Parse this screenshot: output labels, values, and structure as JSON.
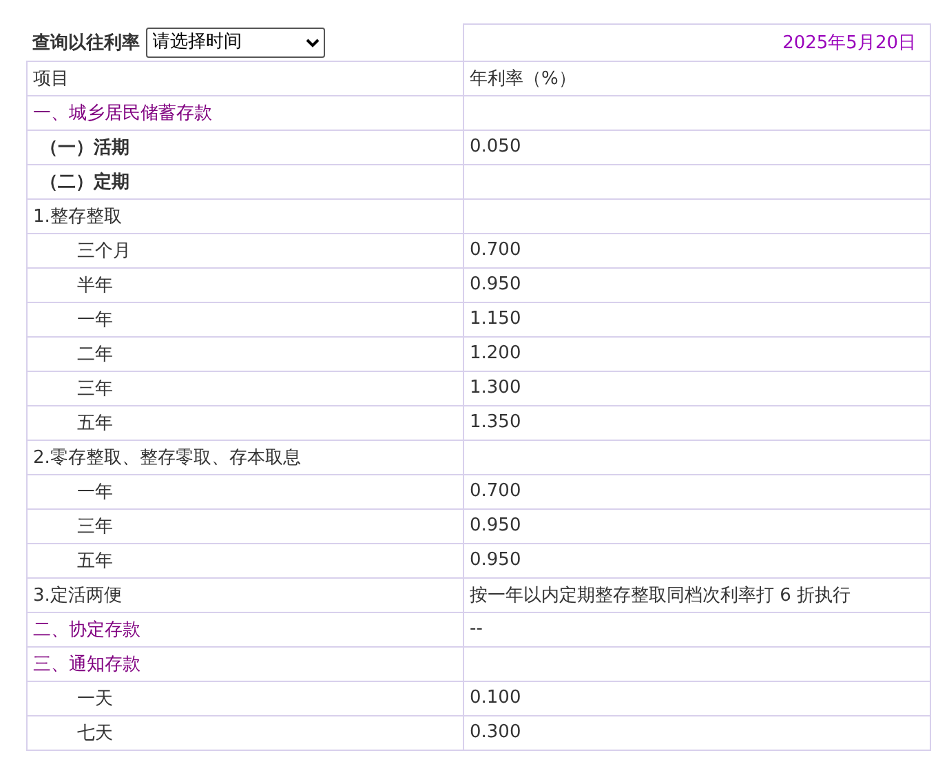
{
  "query": {
    "label": "查询以往利率",
    "select_value": "请选择时间",
    "date": "2025年5月20日"
  },
  "header": {
    "column_1": "项目",
    "column_2": "年利率（%）"
  },
  "rows": [
    {
      "kind": "section",
      "item": "一、城乡居民储蓄存款",
      "rate": ""
    },
    {
      "kind": "sub",
      "item": "（一）活期",
      "rate": "0.050"
    },
    {
      "kind": "sub",
      "item": "（二）定期",
      "rate": ""
    },
    {
      "kind": "group",
      "item": "1.整存整取",
      "rate": ""
    },
    {
      "kind": "item",
      "item": "三个月",
      "rate": "0.700"
    },
    {
      "kind": "item",
      "item": "半年",
      "rate": "0.950"
    },
    {
      "kind": "item",
      "item": "一年",
      "rate": "1.150"
    },
    {
      "kind": "item",
      "item": "二年",
      "rate": "1.200"
    },
    {
      "kind": "item",
      "item": "三年",
      "rate": "1.300"
    },
    {
      "kind": "item",
      "item": "五年",
      "rate": "1.350"
    },
    {
      "kind": "group",
      "item": "2.零存整取、整存零取、存本取息",
      "rate": ""
    },
    {
      "kind": "item",
      "item": "一年",
      "rate": "0.700"
    },
    {
      "kind": "item",
      "item": "三年",
      "rate": "0.950"
    },
    {
      "kind": "item",
      "item": "五年",
      "rate": "0.950"
    },
    {
      "kind": "group",
      "item": "3.定活两便",
      "rate": "按一年以内定期整存整取同档次利率打 6 折执行"
    },
    {
      "kind": "section",
      "item": "二、协定存款",
      "rate": "--"
    },
    {
      "kind": "section",
      "item": "三、通知存款",
      "rate": ""
    },
    {
      "kind": "item",
      "item": "一天",
      "rate": "0.100"
    },
    {
      "kind": "item",
      "item": "七天",
      "rate": "0.300"
    }
  ]
}
